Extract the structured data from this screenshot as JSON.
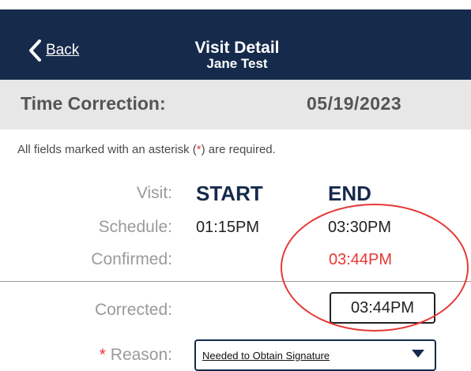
{
  "nav": {
    "back_label": "Back",
    "title": "Visit Detail",
    "subtitle": "Jane Test"
  },
  "band": {
    "label": "Time Correction:",
    "date": "05/19/2023"
  },
  "required_note": {
    "before": "All fields marked with an asterisk (",
    "star": "*",
    "after": ") are required."
  },
  "visit": {
    "label": "Visit:",
    "start_header": "START",
    "end_header": "END"
  },
  "schedule": {
    "label": "Schedule:",
    "start": "01:15PM",
    "end": "03:30PM"
  },
  "confirmed": {
    "label": "Confirmed:",
    "end": "03:44PM"
  },
  "corrected": {
    "label": "Corrected:",
    "end": "03:44PM"
  },
  "reason": {
    "required_mark": "*",
    "label": "Reason:",
    "selected": "Needed to Obtain Signature"
  },
  "colors": {
    "navbar": "#162a4b",
    "accent_red": "#e53935",
    "band": "#e7e7e8"
  },
  "icons": {
    "back": "chevron-left-icon",
    "dropdown": "triangle-down-icon"
  }
}
